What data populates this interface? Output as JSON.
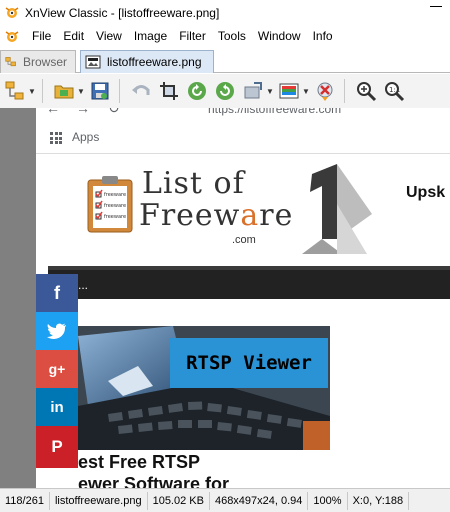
{
  "window": {
    "title": "XnView Classic - [listoffreeware.png]"
  },
  "menu": {
    "items": [
      "File",
      "Edit",
      "View",
      "Image",
      "Filter",
      "Tools",
      "Window",
      "Info"
    ]
  },
  "tabs": [
    {
      "label": "Browser",
      "active": false
    },
    {
      "label": "listoffreeware.png",
      "active": true
    }
  ],
  "toolbar": {
    "buttons": [
      "browser-icon",
      "open-folder-icon",
      "save-icon",
      "undo-icon",
      "crop-icon",
      "rotate-left-icon",
      "rotate-right-icon",
      "resize-icon",
      "color-palette-icon",
      "effects-icon",
      "zoom-in-icon",
      "zoom-fit-icon"
    ]
  },
  "image_content": {
    "url": "https://listoffreeware.com",
    "bookmarks_label": "Apps",
    "logo_line1": "List of",
    "logo_line2a": "Freew",
    "logo_line2b": "a",
    "logo_line2c": "re",
    "logo_com": ".com",
    "clipboard_items": [
      "freeware",
      "freeware",
      "freeware"
    ],
    "header_right": "Upsk",
    "nav_text": "o to...",
    "social": [
      "f",
      "g+",
      "in",
      "P"
    ],
    "banner_text": "RTSP Viewer",
    "article_title_line1": "est Free RTSP",
    "article_title_line2": "ewer Software for"
  },
  "status": {
    "index": "118/261",
    "filename": "listoffreeware.png",
    "filesize": "105.02 KB",
    "dimensions": "468x497x24, 0.94",
    "zoom": "100%",
    "coords": "X:0, Y:188"
  },
  "colors": {
    "tab_active": "#dde8f6",
    "facebook": "#3b5998",
    "twitter": "#1da1f2",
    "googleplus": "#dc4e41",
    "linkedin": "#0077b5",
    "pinterest": "#cb2027",
    "banner": "#2a93d5",
    "logo_accent": "#d9712b"
  }
}
